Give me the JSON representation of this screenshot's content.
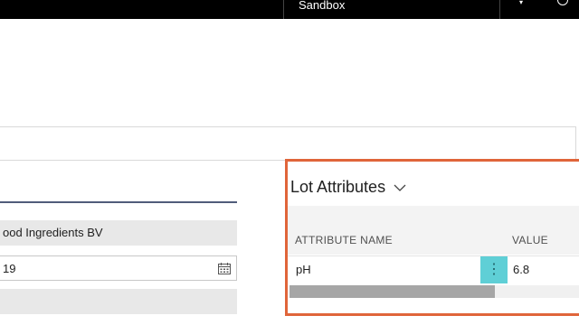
{
  "topbar": {
    "environment": "Sandbox",
    "icons": [
      "bell-icon",
      "help-icon"
    ]
  },
  "form": {
    "fields": [
      {
        "value": "ood Ingredients BV"
      },
      {
        "value": "19"
      },
      {
        "value": ""
      }
    ],
    "icons": [
      "calendar-icon"
    ]
  },
  "lot_attributes": {
    "title": "Lot Attributes",
    "columns": {
      "name": "ATTRIBUTE NAME",
      "value": "VALUE"
    },
    "rows": [
      {
        "name": "pH",
        "value": "6.8"
      }
    ],
    "icons": [
      "chevron-down-icon",
      "more-vertical-icon"
    ],
    "highlight_color": "#e0653a",
    "accent_color": "#5fcfd6"
  }
}
